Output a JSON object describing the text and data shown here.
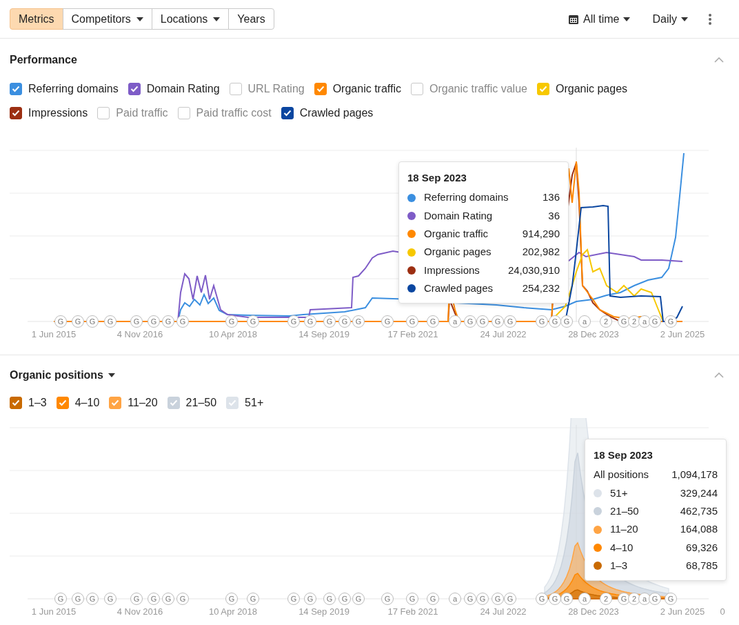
{
  "toolbar": {
    "tabs": [
      {
        "label": "Metrics",
        "selected": true,
        "dropdown": false
      },
      {
        "label": "Competitors",
        "selected": false,
        "dropdown": true
      },
      {
        "label": "Locations",
        "selected": false,
        "dropdown": true
      },
      {
        "label": "Years",
        "selected": false,
        "dropdown": false
      }
    ],
    "date_range": "All time",
    "interval": "Daily"
  },
  "performance": {
    "title": "Performance",
    "metrics": [
      {
        "label": "Referring domains",
        "checked": true,
        "color": "#3b8fe0"
      },
      {
        "label": "Domain Rating",
        "checked": true,
        "color": "#7e5cc7"
      },
      {
        "label": "URL Rating",
        "checked": false
      },
      {
        "label": "Organic traffic",
        "checked": true,
        "color": "#ff8800"
      },
      {
        "label": "Organic traffic value",
        "checked": false
      },
      {
        "label": "Organic pages",
        "checked": true,
        "color": "#f7c800"
      },
      {
        "label": "Impressions",
        "checked": true,
        "color": "#9c2f12"
      },
      {
        "label": "Paid traffic",
        "checked": false
      },
      {
        "label": "Paid traffic cost",
        "checked": false
      },
      {
        "label": "Crawled pages",
        "checked": true,
        "color": "#0a46a0"
      }
    ],
    "chart": {
      "x_labels": [
        "1 Jun 2015",
        "4 Nov 2016",
        "10 Apr 2018",
        "14 Sep 2019",
        "17 Feb 2021",
        "24 Jul 2022",
        "28 Dec 2023",
        "2 Jun 2025"
      ],
      "markers": [
        "G",
        "G",
        "G",
        "G",
        "G",
        "G",
        "G",
        "G",
        "G",
        "G",
        "G",
        "G",
        "G",
        "G",
        "G",
        "G",
        "G",
        "G",
        "a",
        "G",
        "G",
        "G",
        "G",
        "G",
        "G",
        "G",
        "a",
        "2",
        "G",
        "2",
        "a",
        "G",
        "G"
      ],
      "tooltip": {
        "date": "18 Sep 2023",
        "rows": [
          {
            "label": "Referring domains",
            "value": "136",
            "color": "#3b8fe0"
          },
          {
            "label": "Domain Rating",
            "value": "36",
            "color": "#7e5cc7"
          },
          {
            "label": "Organic traffic",
            "value": "914,290",
            "color": "#ff8800"
          },
          {
            "label": "Organic pages",
            "value": "202,982",
            "color": "#f7c800"
          },
          {
            "label": "Impressions",
            "value": "24,030,910",
            "color": "#9c2f12"
          },
          {
            "label": "Crawled pages",
            "value": "254,232",
            "color": "#0a46a0"
          }
        ]
      }
    }
  },
  "organic_positions": {
    "title": "Organic positions",
    "groups": [
      {
        "label": "1–3",
        "checked": true,
        "color": "#c96a00"
      },
      {
        "label": "4–10",
        "checked": true,
        "color": "#ff8800"
      },
      {
        "label": "11–20",
        "checked": true,
        "color": "#ffa444"
      },
      {
        "label": "21–50",
        "checked": true,
        "color": "#c9d2dc"
      },
      {
        "label": "51+",
        "checked": true,
        "color": "#dde3ea"
      }
    ],
    "chart": {
      "x_labels": [
        "1 Jun 2015",
        "4 Nov 2016",
        "10 Apr 2018",
        "14 Sep 2019",
        "17 Feb 2021",
        "24 Jul 2022",
        "28 Dec 2023",
        "2 Jun 2025"
      ],
      "y_label": "0",
      "markers": [
        "G",
        "G",
        "G",
        "G",
        "G",
        "G",
        "G",
        "G",
        "G",
        "G",
        "G",
        "G",
        "G",
        "G",
        "G",
        "G",
        "G",
        "G",
        "a",
        "G",
        "G",
        "G",
        "G",
        "G",
        "G",
        "G",
        "a",
        "2",
        "G",
        "2",
        "a",
        "G",
        "G"
      ],
      "tooltip": {
        "date": "18 Sep 2023",
        "total": {
          "label": "All positions",
          "value": "1,094,178"
        },
        "rows": [
          {
            "label": "51+",
            "value": "329,244",
            "color": "#dde3ea"
          },
          {
            "label": "21–50",
            "value": "462,735",
            "color": "#c9d2dc"
          },
          {
            "label": "11–20",
            "value": "164,088",
            "color": "#ffa444"
          },
          {
            "label": "4–10",
            "value": "69,326",
            "color": "#ff8800"
          },
          {
            "label": "1–3",
            "value": "68,785",
            "color": "#c96a00"
          }
        ]
      }
    }
  }
}
